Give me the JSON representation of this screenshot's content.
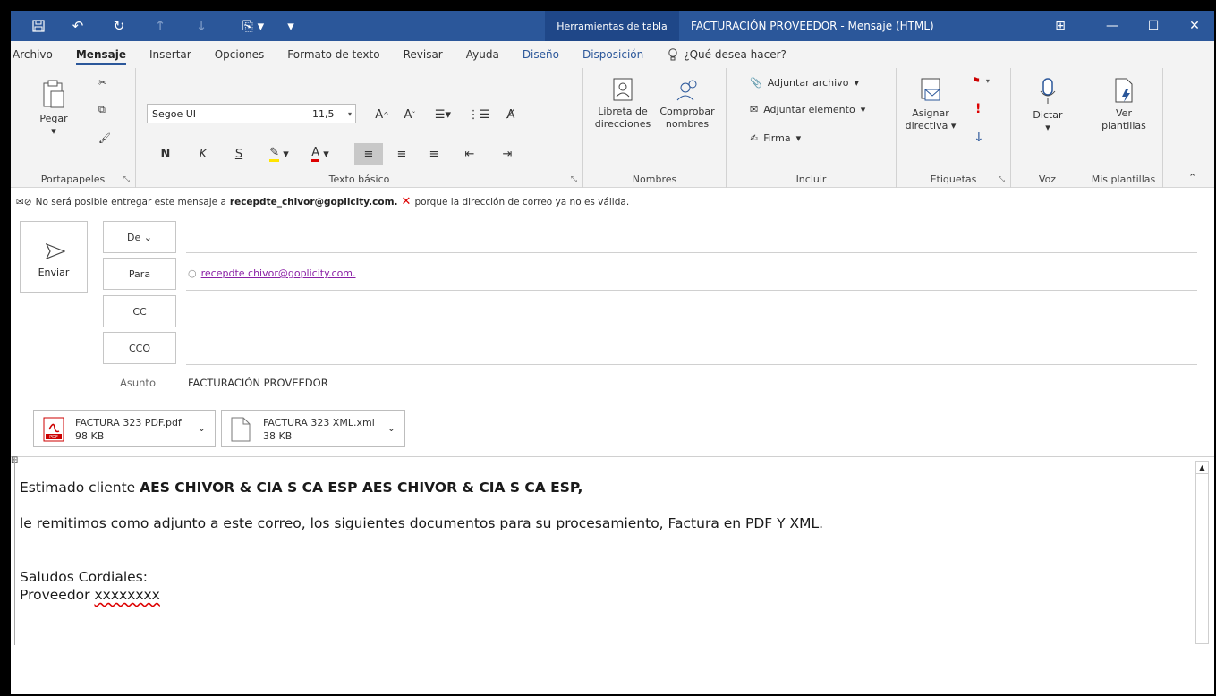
{
  "titlebar": {
    "tool_tab": "Herramientas de tabla",
    "title": "FACTURACIÓN PROVEEDOR  -  Mensaje (HTML)",
    "color": "#2b579a"
  },
  "menu": {
    "items": [
      "Archivo",
      "Mensaje",
      "Insertar",
      "Opciones",
      "Formato de texto",
      "Revisar",
      "Ayuda",
      "Diseño",
      "Disposición"
    ],
    "tell_me": "¿Qué desea hacer?"
  },
  "ribbon": {
    "clipboard": {
      "paste": "Pegar",
      "label": "Portapapeles"
    },
    "basic_text": {
      "font": "Segoe UI",
      "size": "11,5",
      "bold": "N",
      "italic": "K",
      "underline": "S",
      "label": "Texto básico"
    },
    "names": {
      "address_book": "Libreta de direcciones",
      "address_book_l1": "Libreta de",
      "address_book_l2": "direcciones",
      "check_names_l1": "Comprobar",
      "check_names_l2": "nombres",
      "label": "Nombres"
    },
    "include": {
      "attach_file": "Adjuntar archivo",
      "attach_item": "Adjuntar elemento",
      "signature": "Firma",
      "label": "Incluir"
    },
    "tags": {
      "assign_l1": "Asignar",
      "assign_l2": "directiva",
      "label": "Etiquetas"
    },
    "voice": {
      "dictate": "Dictar",
      "label": "Voz"
    },
    "templates": {
      "view_l1": "Ver",
      "view_l2": "plantillas",
      "label": "Mis plantillas"
    }
  },
  "info": {
    "pre": "No será posible entregar este mensaje a",
    "address": "recepdte_chivor@goplicity.com.",
    "post": "porque la dirección de correo ya no es válida."
  },
  "compose": {
    "send": "Enviar",
    "from": "De",
    "to": "Para",
    "cc": "CC",
    "bcc": "CCO",
    "to_value": "recepdte chivor@goplicity.com.",
    "subject_label": "Asunto",
    "subject": "FACTURACIÓN PROVEEDOR"
  },
  "attachments": [
    {
      "name": "FACTURA 323 PDF.pdf",
      "size": "98 KB",
      "type": "PDF"
    },
    {
      "name": "FACTURA 323 XML.xml",
      "size": "38 KB"
    }
  ],
  "body": {
    "greeting_pre": "Estimado cliente ",
    "greeting_bold": "AES CHIVOR & CIA S CA ESP AES CHIVOR & CIA S CA ESP,",
    "line1": "le remitimos como adjunto a este correo, los siguientes documentos para su procesamiento, Factura en PDF Y XML.",
    "closing": "Saludos Cordiales:",
    "sender_pre": "Proveedor ",
    "sender_name": "xxxxxxxx"
  }
}
